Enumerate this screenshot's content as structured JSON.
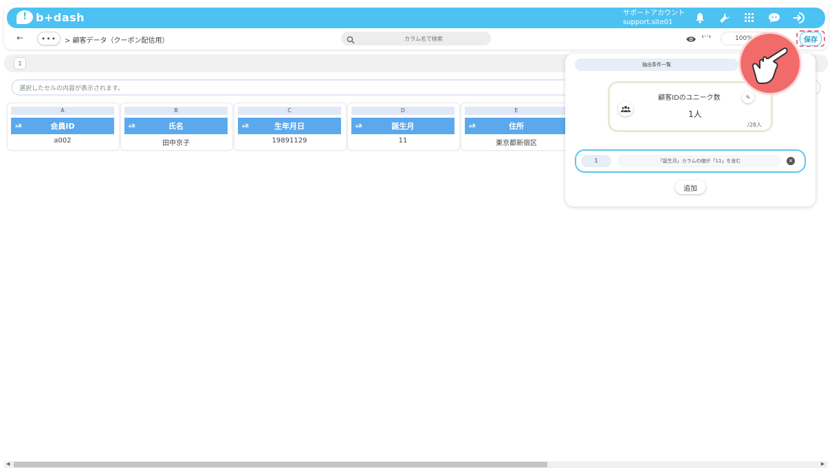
{
  "app": {
    "logo_text": "b+dash",
    "brand_color": "#4cc2f2"
  },
  "account": {
    "line1": "サポートアカウント",
    "line2": "support.site01"
  },
  "top_icons": [
    "bell-icon",
    "wrench-icon",
    "grid-icon",
    "chat-bot-icon",
    "logout-icon"
  ],
  "toolbar": {
    "more_label": "•••",
    "breadcrumb": "> 顧客データ（クーポン配信用）",
    "search_placeholder": "カラム名で検索",
    "code_label": "‹··›",
    "zoom": "100%",
    "save_label": "保存"
  },
  "page_tabs": [
    "1"
  ],
  "cell_bar": {
    "text": "選択したセルの内容が表示されます。"
  },
  "columns": [
    {
      "letter": "A",
      "type": "aあ",
      "name": "会員ID",
      "value": "a002"
    },
    {
      "letter": "B",
      "type": "aあ",
      "name": "氏名",
      "value": "田中京子"
    },
    {
      "letter": "C",
      "type": "aあ",
      "name": "生年月日",
      "value": "19891129"
    },
    {
      "letter": "D",
      "type": "aあ",
      "name": "誕生月",
      "value": "11"
    },
    {
      "letter": "E",
      "type": "aあ",
      "name": "住所",
      "value": "東京都新宿区"
    }
  ],
  "filter_panel": {
    "tab_label": "抽出条件一覧",
    "unique_title": "顧客IDのユニーク数",
    "unique_count": "1人",
    "unique_total": "/28人",
    "conditions": [
      {
        "num": "1",
        "text": "「誕生月」カラムの値が「11」を含む"
      }
    ],
    "add_label": "追加"
  }
}
